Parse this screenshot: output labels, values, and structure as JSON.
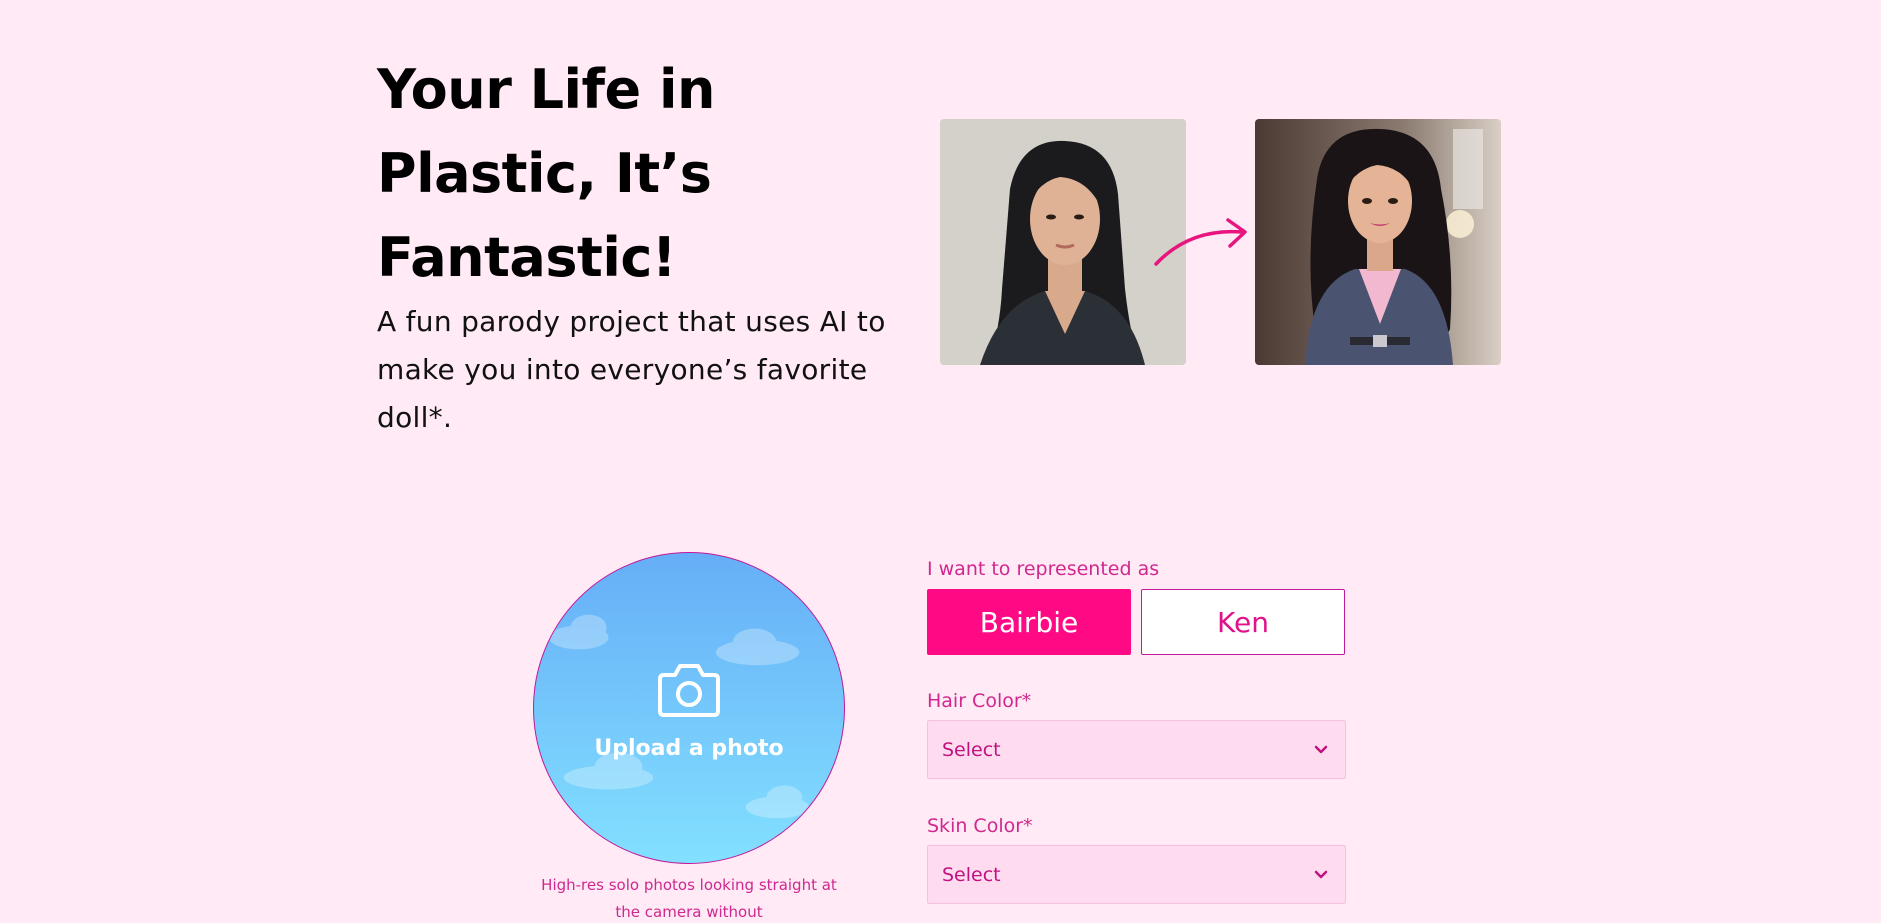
{
  "hero": {
    "title": "Your Life in Plastic, It’s Fantastic!",
    "subtitle": "A fun parody project that uses AI to make you into everyone’s favorite doll*."
  },
  "examples": {
    "before_photo": "portrait-photo",
    "after_photo": "doll-portrait",
    "arrow_icon": "arrow-right-icon"
  },
  "upload": {
    "label": "Upload a photo",
    "icon": "camera-icon",
    "hint": "High-res solo photos looking straight at the camera without"
  },
  "form": {
    "represent_label": "I want to represented as",
    "options": [
      "Bairbie",
      "Ken"
    ],
    "selected_option": "Bairbie",
    "hair_label": "Hair Color*",
    "hair_value": "Select",
    "skin_label": "Skin Color*",
    "skin_value": "Select"
  },
  "colors": {
    "background": "#ffeaf5",
    "accent": "#ff0a84",
    "label_pink": "#d0288f",
    "select_bg": "#ffdbf0"
  }
}
